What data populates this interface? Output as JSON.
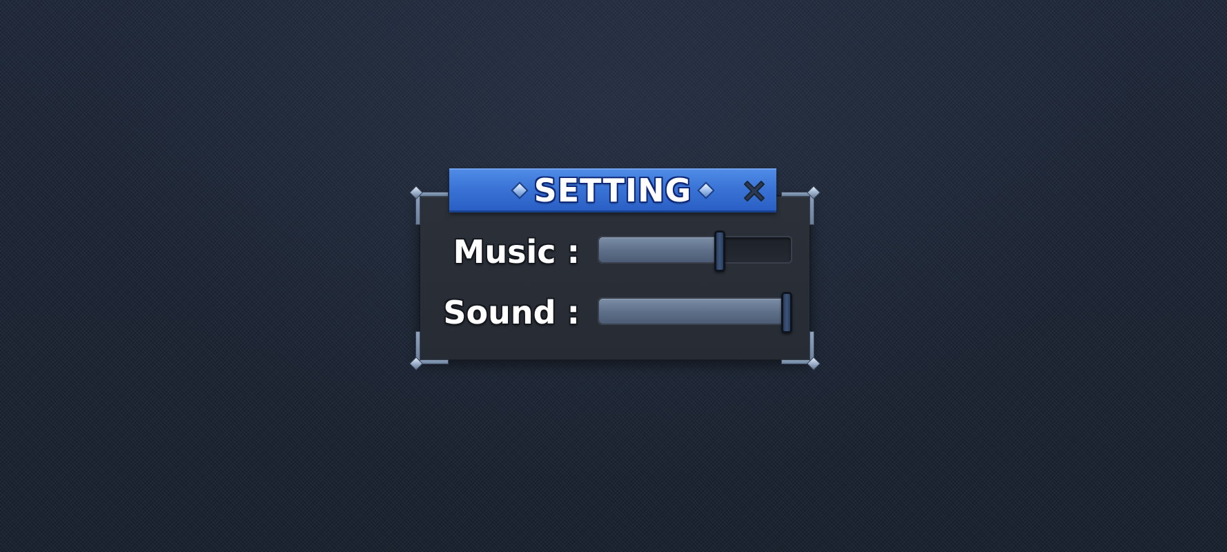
{
  "dialog": {
    "title": "SETTING",
    "close_icon": "close-x-icon",
    "title_gem_icon": "diamond-gem-icon",
    "colors": {
      "banner": "#3a74d6",
      "banner_outline": "#0f2a7a",
      "panel": "#2a2f37",
      "slider_fill": "#6a7d96",
      "handle": "#2f4466"
    }
  },
  "settings": [
    {
      "key": "music",
      "label": "Music :",
      "value": 0.63
    },
    {
      "key": "sound",
      "label": "Sound :",
      "value": 1.0
    }
  ]
}
